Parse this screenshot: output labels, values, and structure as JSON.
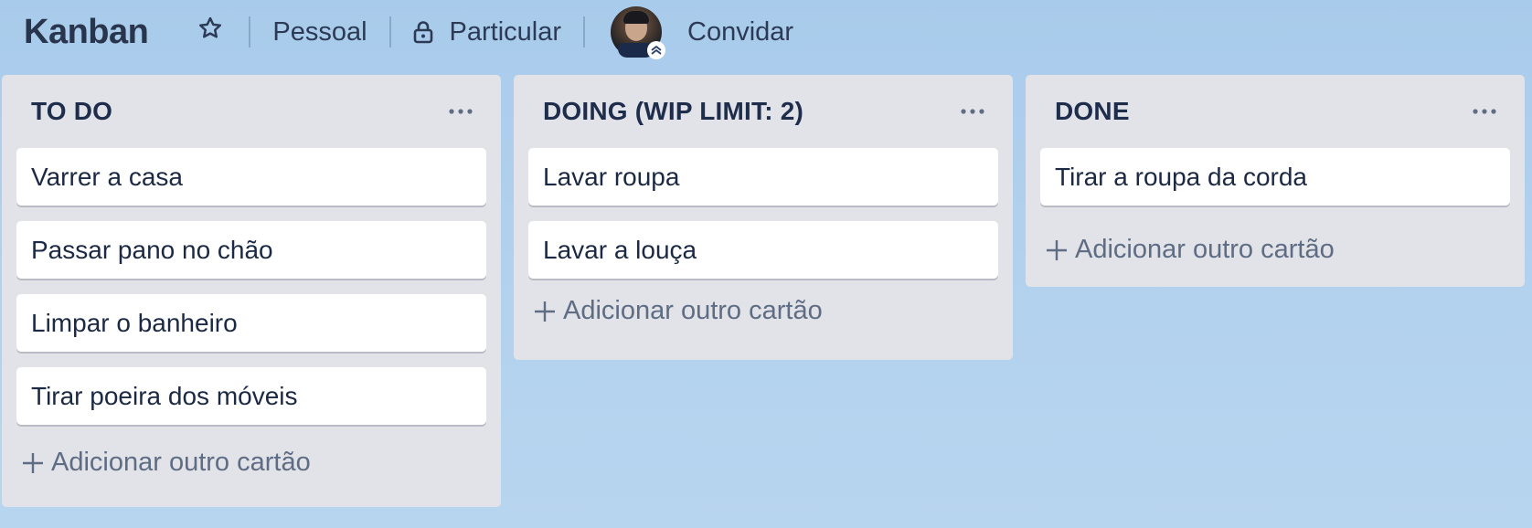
{
  "board": {
    "title": "Kanban",
    "visibility_team": "Pessoal",
    "privacy": "Particular",
    "invite_label": "Convidar"
  },
  "icons": {
    "star": "star-outline-icon",
    "lock": "lock-icon",
    "menu": "ellipsis-icon",
    "plus": "plus-icon",
    "admin_badge": "chevron-up-double-icon"
  },
  "colors": {
    "background": "#b3d2ee",
    "list_background": "#e1e3e8",
    "card_background": "#ffffff",
    "title_text": "#172b4d",
    "muted_text": "#5e6c84"
  },
  "lists": [
    {
      "title": "TO DO",
      "cards": [
        "Varrer a casa",
        "Passar pano no chão",
        "Limpar o banheiro",
        "Tirar poeira dos móveis"
      ],
      "add_card_label": "Adicionar outro cartão"
    },
    {
      "title": "DOING (WIP LIMIT: 2)",
      "cards": [
        "Lavar roupa",
        "Lavar a louça"
      ],
      "add_card_label": "Adicionar outro cartão"
    },
    {
      "title": "DONE",
      "cards": [
        "Tirar a roupa da corda"
      ],
      "add_card_label": "Adicionar outro cartão"
    }
  ]
}
